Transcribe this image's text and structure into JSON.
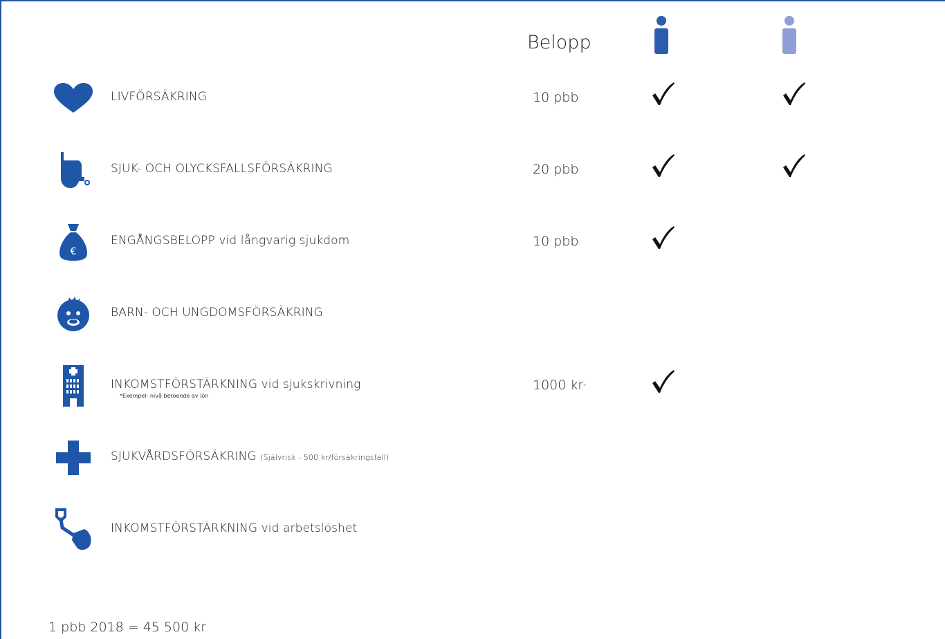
{
  "header": {
    "amount_column": "Belopp",
    "person_icons": [
      "person-icon-dark-blue",
      "person-icon-light-blue"
    ]
  },
  "colors": {
    "icon_blue": "#1f56a8",
    "person_primary": "#2a5db0",
    "person_secondary": "#8f9fd6",
    "frame": "#1f56a8"
  },
  "rows": [
    {
      "icon": "heart-icon",
      "label": "LIVFÖRSÄKRING",
      "amount": "10 pbb",
      "primary": true,
      "secondary": true
    },
    {
      "icon": "wheelchair-icon",
      "label": "SJUK- OCH OLYCKSFALLSFÖRSÄKRING",
      "amount": "20 pbb",
      "primary": true,
      "secondary": true
    },
    {
      "icon": "money-bag-icon",
      "label": "ENGÅNGSBELOPP vid långvarig sjukdom",
      "amount": "10 pbb",
      "primary": true,
      "secondary": false
    },
    {
      "icon": "child-face-icon",
      "label": "BARN- OCH UNGDOMSFÖRSÄKRING",
      "amount": "",
      "primary": false,
      "secondary": false
    },
    {
      "icon": "hospital-building-icon",
      "label": "INKOMSTFÖRSTÄRKNING vid sjukskrivning",
      "note": "*Exempel- nivå beroende av lön",
      "amount": "1000 kr",
      "amount_mark": "*",
      "primary": true,
      "secondary": false
    },
    {
      "icon": "medical-cross-icon",
      "label": "SJUKVÅRDSFÖRSÄKRING",
      "label_small": "(Självrisk - 500 kr/försäkringsfall)",
      "amount": "",
      "primary": false,
      "secondary": false
    },
    {
      "icon": "shovel-icon",
      "label": "INKOMSTFÖRSTÄRKNING vid arbetslöshet",
      "amount": "",
      "primary": false,
      "secondary": false
    }
  ],
  "footer": "1 pbb 2018 = 45 500 kr"
}
